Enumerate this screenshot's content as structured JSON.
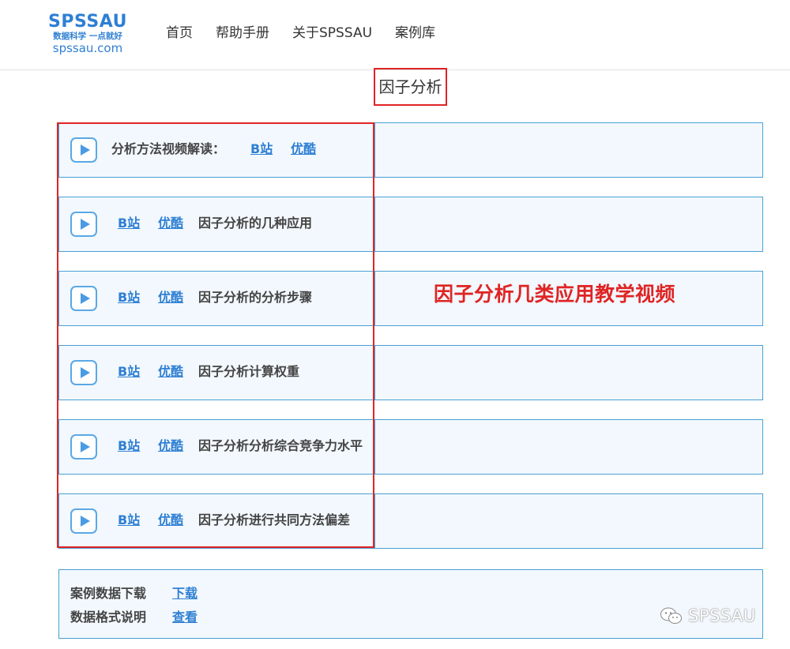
{
  "header": {
    "logo": {
      "brand": "SPSSAU",
      "slogan": "数据科学 一点就好",
      "domain": "spssau.com"
    },
    "nav": [
      "首页",
      "帮助手册",
      "关于SPSSAU",
      "案例库"
    ]
  },
  "page_title": "因子分析",
  "intro_row": {
    "label": "分析方法视频解读：",
    "links": [
      "B站",
      "优酷"
    ]
  },
  "video_rows": [
    {
      "links": [
        "B站",
        "优酷"
      ],
      "title": "因子分析的几种应用"
    },
    {
      "links": [
        "B站",
        "优酷"
      ],
      "title": "因子分析的分析步骤"
    },
    {
      "links": [
        "B站",
        "优酷"
      ],
      "title": "因子分析计算权重"
    },
    {
      "links": [
        "B站",
        "优酷"
      ],
      "title": "因子分析分析综合竞争力水平"
    },
    {
      "links": [
        "B站",
        "优酷"
      ],
      "title": "因子分析进行共同方法偏差"
    }
  ],
  "annotation": "因子分析几类应用教学视频",
  "case_data": [
    {
      "label": "案例数据下载",
      "link": "下载"
    },
    {
      "label": "数据格式说明",
      "link": "查看"
    }
  ],
  "watermark": "SPSSAU",
  "colors": {
    "accent": "#2e7fd3",
    "highlight": "#e02424",
    "row_bg": "#f2f8fd",
    "row_border": "#4aa0d4"
  },
  "icons": {
    "play": "play-icon",
    "watermark": "wechat-icon"
  }
}
